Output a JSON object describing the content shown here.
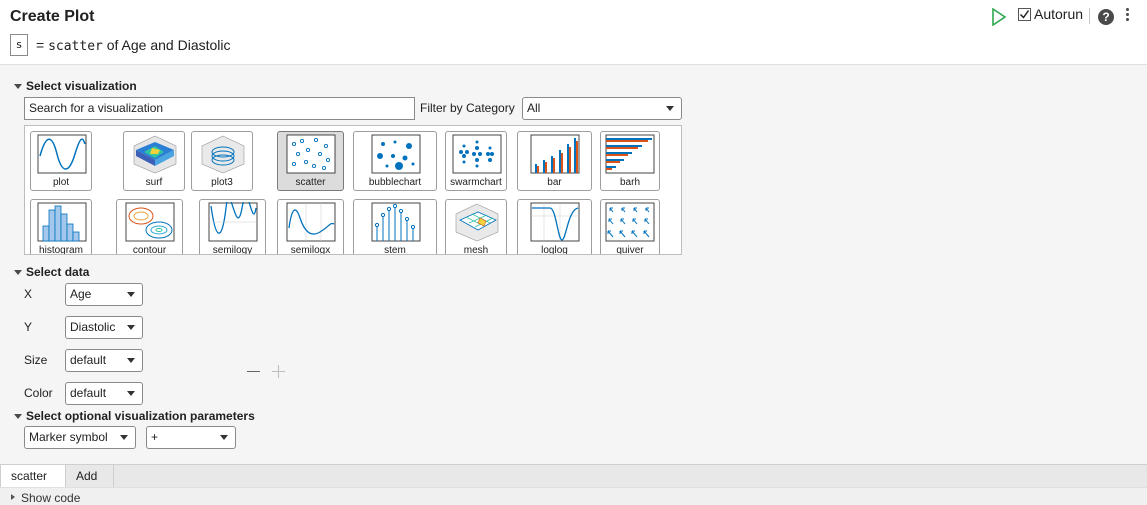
{
  "header": {
    "title": "Create Plot",
    "output_var": "s",
    "equals": "=",
    "function_name": "scatter",
    "description": "of Age and Diastolic",
    "autorun_label": "Autorun",
    "autorun_checked": true,
    "help_symbol": "?"
  },
  "sections": {
    "visualization": "Select visualization",
    "data": "Select data",
    "optional": "Select optional visualization parameters"
  },
  "search": {
    "placeholder": "Search for a visualization"
  },
  "filter": {
    "label": "Filter by Category",
    "value": "All"
  },
  "gallery": {
    "row1": [
      "plot",
      "surf",
      "plot3",
      "scatter",
      "bubblechart",
      "swarmchart",
      "bar",
      "barh"
    ],
    "row2": [
      "histogram",
      "contour",
      "semilogy",
      "semilogx",
      "stem",
      "mesh",
      "loglog",
      "quiver"
    ],
    "selected": "scatter"
  },
  "data_fields": {
    "x": {
      "label": "X",
      "value": "Age"
    },
    "y": {
      "label": "Y",
      "value": "Diastolic"
    },
    "size": {
      "label": "Size",
      "value": "default"
    },
    "color": {
      "label": "Color",
      "value": "default"
    }
  },
  "optional_params": {
    "param": "Marker symbol",
    "value": "+"
  },
  "tabs": [
    "scatter",
    "Add"
  ],
  "footer": {
    "show_code": "Show code"
  },
  "colors": {
    "accent_blue": "#0072bd",
    "run_green": "#2fa84f",
    "panel_bg": "#f5f5f5"
  }
}
